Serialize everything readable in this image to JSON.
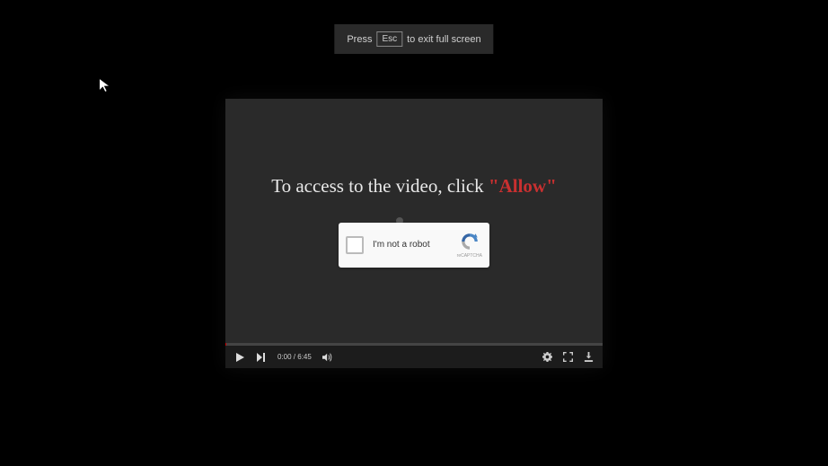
{
  "escNotice": {
    "prefix": "Press",
    "key": "Esc",
    "suffix": "to exit full screen"
  },
  "video": {
    "messagePrefix": "To access to the video, click ",
    "messageHighlight": "\"Allow\""
  },
  "captcha": {
    "label": "I'm not a robot",
    "brand": "reCAPTCHA"
  },
  "controls": {
    "currentTime": "0:00",
    "duration": "6:45"
  }
}
